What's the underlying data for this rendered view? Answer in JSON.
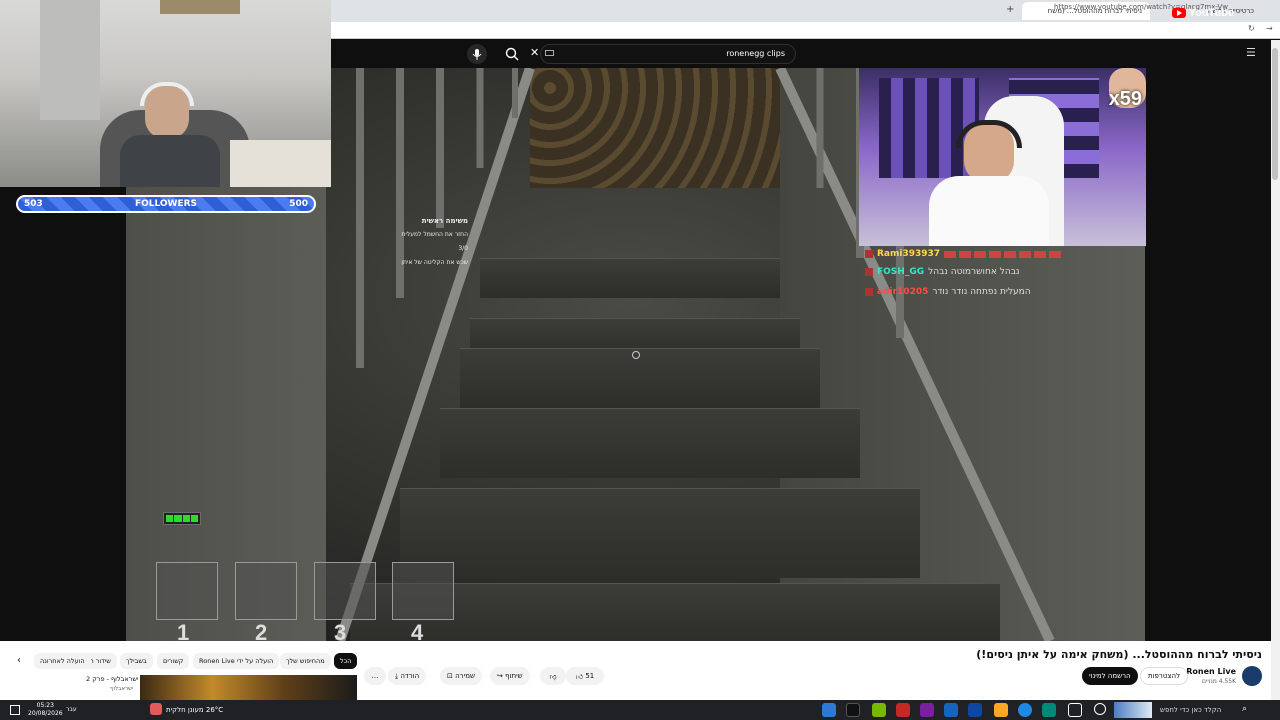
{
  "browser": {
    "tabs": [
      {
        "label": "ניסיתי לברוח מההוסטל... (משח",
        "active": true
      },
      {
        "label": "כרטיסייה חדשה",
        "active": false
      }
    ],
    "url": "https://www.youtube.com/watch?v=glacg7mx-Vw"
  },
  "youtube": {
    "logo_text": "YouTube",
    "search_value": "ronenegg clips",
    "search_keyboard_icon": "keyboard-icon"
  },
  "game": {
    "hud_title": "משימה ראשית",
    "hud_lines": [
      "החזר את החשמל למעלית 3/0",
      "שכש את הקליטה של איתן"
    ],
    "slots": [
      "1",
      "2",
      "3",
      "4"
    ],
    "battery_level": 1.0
  },
  "overlay": {
    "followers_label": "FOLLOWERS",
    "followers_current": "503",
    "followers_goal": "500",
    "multiplier": "x59",
    "chat": [
      {
        "name": "Rami393937",
        "text": "",
        "color": "#ffd84a"
      },
      {
        "name": "FOSH_GG",
        "text": "נבהל אחושרמוטה נבהל",
        "color": "#37e6c8"
      },
      {
        "name": "adir10205",
        "text": "המעלית נפתחה נודר נודר",
        "color": "#ff4b4b"
      }
    ]
  },
  "video_info": {
    "title": "ניסיתי לברוח מההוסטל... (משחק אימה על איתן ניסים!)",
    "channel": "Ronen Live",
    "subscribers": "4.55K מנויים",
    "subscribe_label": "הרשמה למינוי",
    "join_label": "להצטרפות",
    "likes": "51",
    "share_label": "שיתוף",
    "save_label": "שמירה",
    "download_label": "הורדה",
    "more_label": "..."
  },
  "chips": [
    "הכל",
    "מהחיפוש שלך",
    "הועלה על ידי Ronen Live",
    "קשורים",
    "בשבילך",
    "שידור חי",
    "הועלה לאחרונה"
  ],
  "next_video": {
    "title": "ישראבלוף - פרק 2",
    "channel": "ישראבלוף"
  },
  "taskbar": {
    "search_placeholder": "הקלד כאן כדי לחפש",
    "weather": "26°C מעונן חלקית",
    "time": "05:23",
    "date": "20/08/2026",
    "language": "עבר"
  }
}
